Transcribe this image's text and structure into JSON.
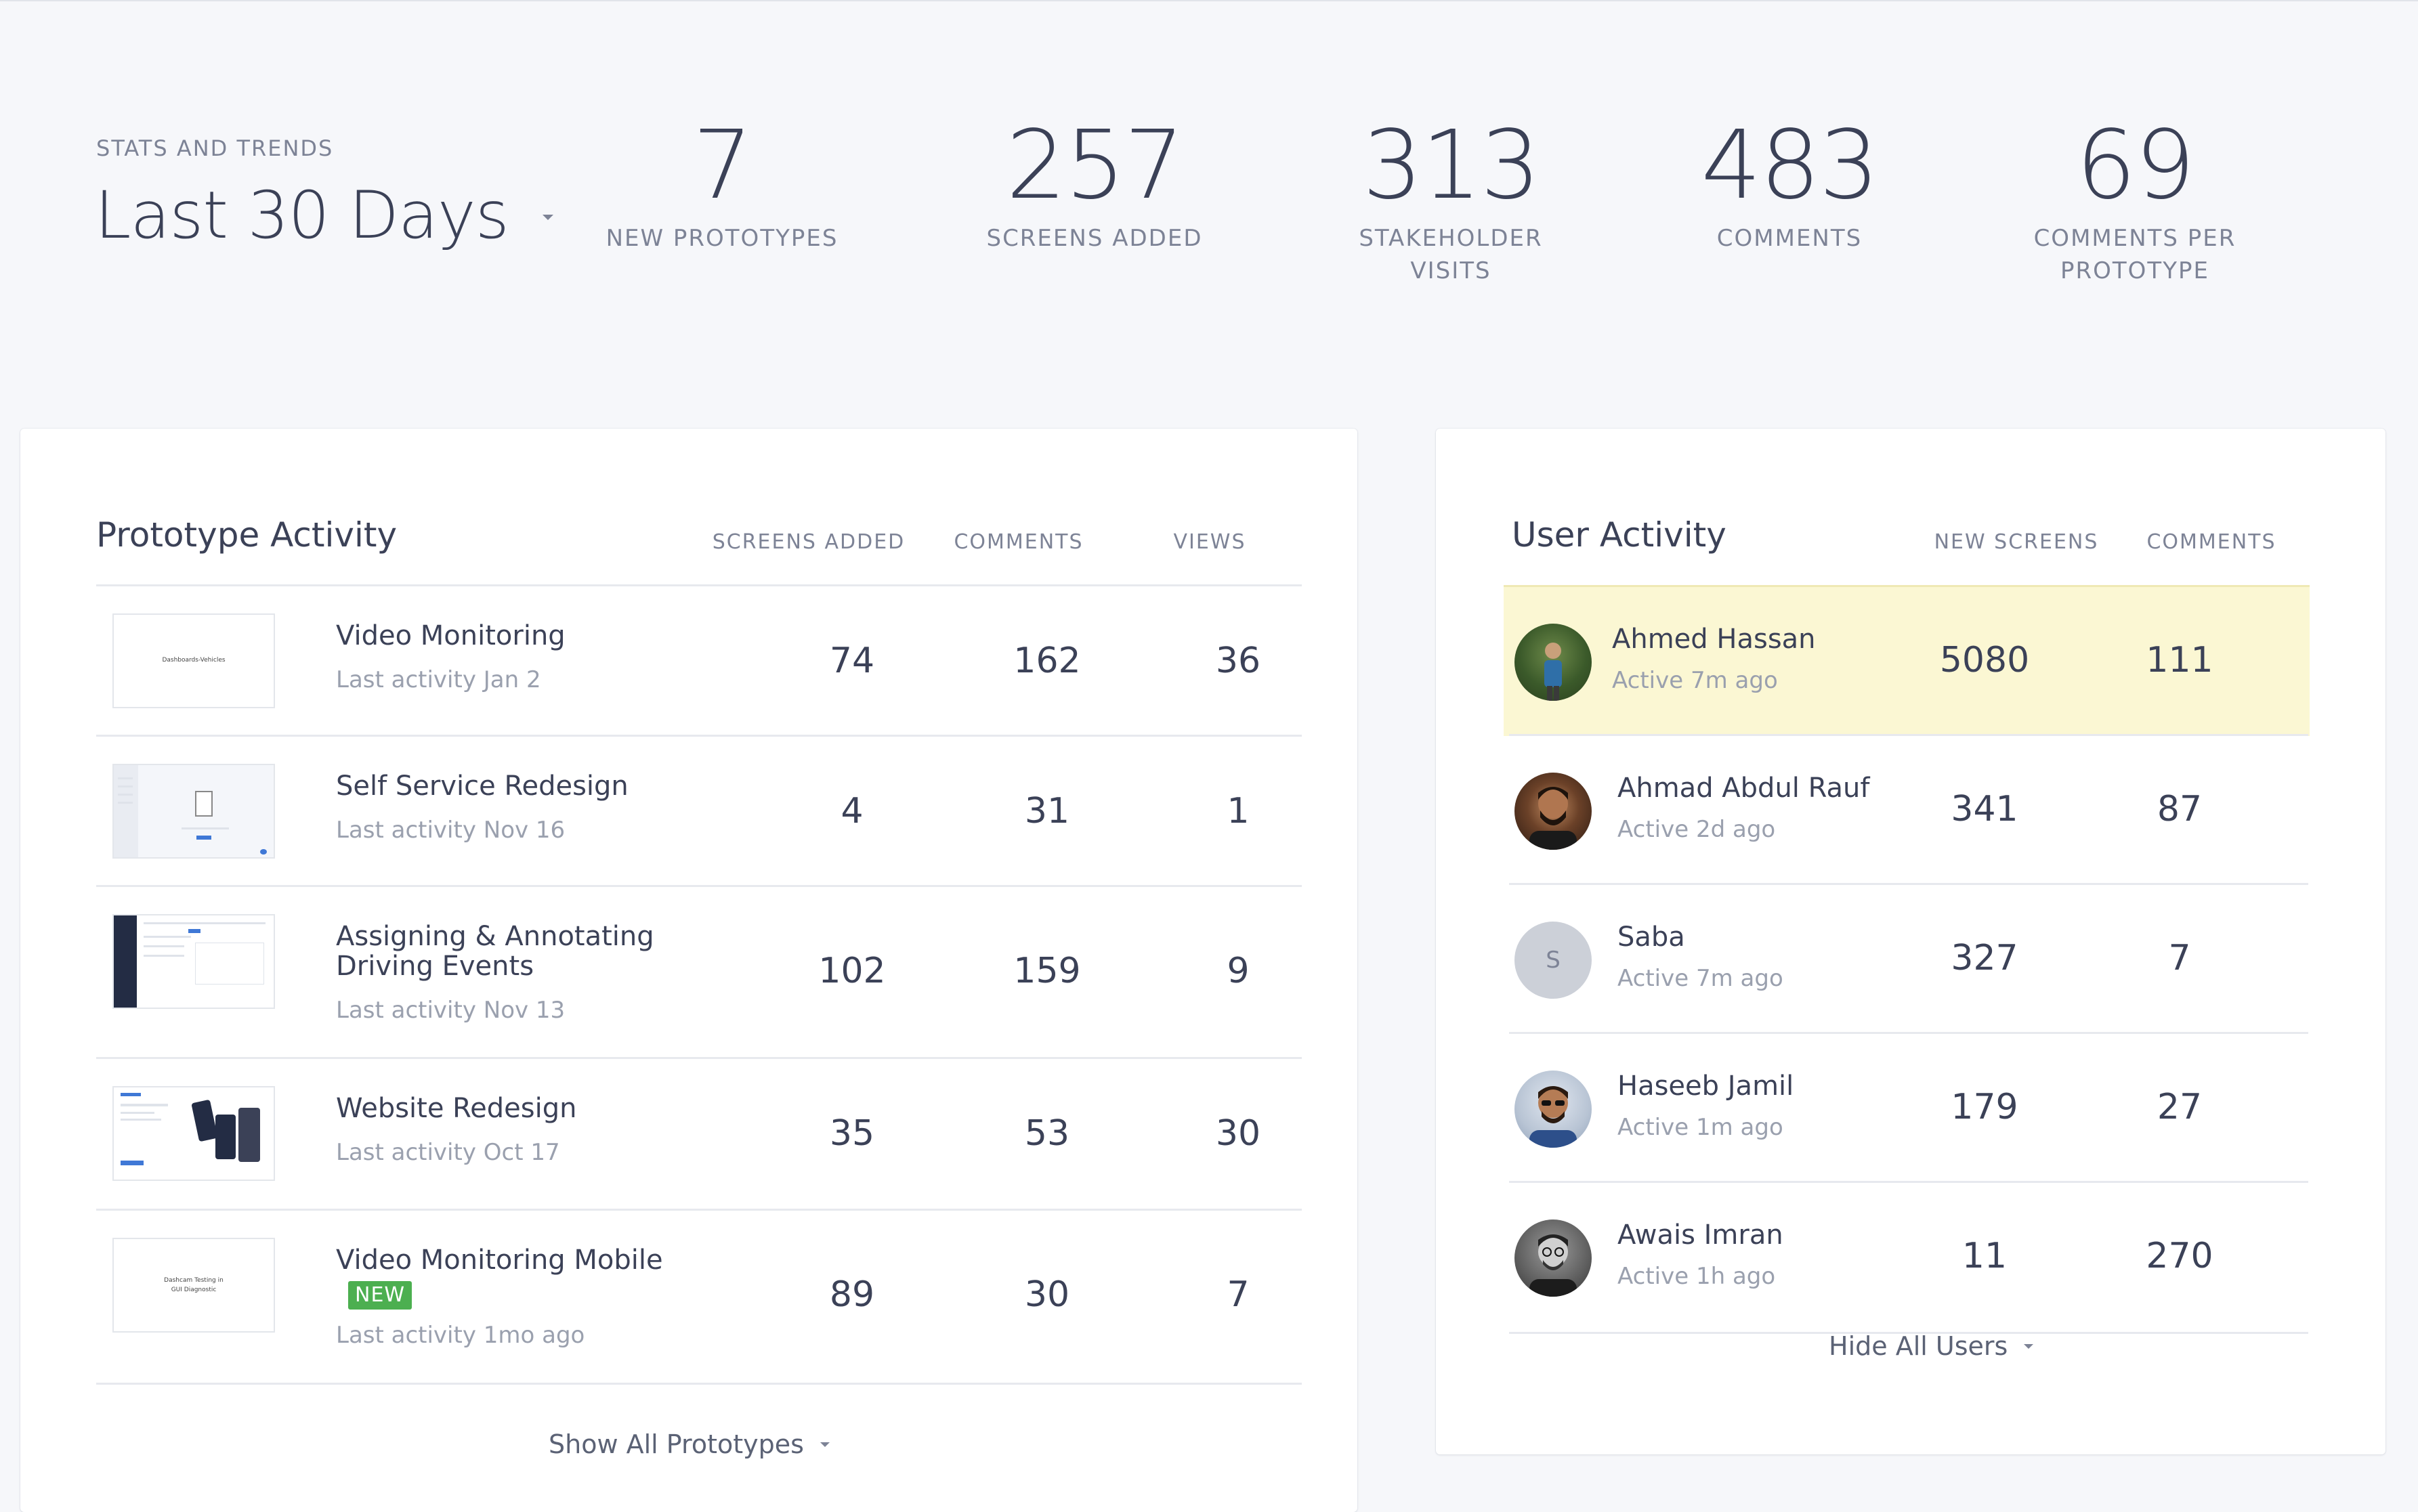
{
  "stats": {
    "heading": "STATS AND TRENDS",
    "range": "Last 30 Days",
    "items": [
      {
        "value": "7",
        "label": "NEW PROTOTYPES"
      },
      {
        "value": "257",
        "label": "SCREENS ADDED"
      },
      {
        "value": "313",
        "label": "STAKEHOLDER",
        "label2": "VISITS"
      },
      {
        "value": "483",
        "label": "COMMENTS"
      },
      {
        "value": "69",
        "label": "COMMENTS PER",
        "label2": "PROTOTYPE"
      }
    ]
  },
  "prototype_activity": {
    "title": "Prototype Activity",
    "columns": [
      "SCREENS ADDED",
      "COMMENTS",
      "VIEWS"
    ],
    "rows": [
      {
        "name": "Video Monitoring",
        "activity": "Last activity Jan 2",
        "screens": "74",
        "comments": "162",
        "views": "36",
        "thumb_text": "Dashboards-Vehicles"
      },
      {
        "name": "Self Service Redesign",
        "activity": "Last activity Nov 16",
        "screens": "4",
        "comments": "31",
        "views": "1"
      },
      {
        "name": "Assigning & Annotating",
        "name2": "Driving Events",
        "activity": "Last activity Nov 13",
        "screens": "102",
        "comments": "159",
        "views": "9"
      },
      {
        "name": "Website Redesign",
        "activity": "Last activity Oct 17",
        "screens": "35",
        "comments": "53",
        "views": "30"
      },
      {
        "name": "Video Monitoring Mobile",
        "badge": "NEW",
        "activity": "Last activity 1mo ago",
        "screens": "89",
        "comments": "30",
        "views": "7",
        "thumb_text": "Dashcam Testing in",
        "thumb_text2": "GUI Diagnostic"
      }
    ],
    "show_all": "Show All Prototypes"
  },
  "user_activity": {
    "title": "User Activity",
    "columns": [
      "NEW SCREENS",
      "COMMENTS"
    ],
    "rows": [
      {
        "name": "Ahmed Hassan",
        "status": "Active 7m ago",
        "screens": "5080",
        "comments": "111",
        "highlighted": true
      },
      {
        "name": "Ahmad Abdul Rauf",
        "status": "Active 2d ago",
        "screens": "341",
        "comments": "87"
      },
      {
        "name": "Saba",
        "initial": "S",
        "status": "Active 7m ago",
        "screens": "327",
        "comments": "7"
      },
      {
        "name": "Haseeb Jamil",
        "status": "Active 1m ago",
        "screens": "179",
        "comments": "27"
      },
      {
        "name": "Awais Imran",
        "status": "Active 1h ago",
        "screens": "11",
        "comments": "270"
      }
    ],
    "hide_all": "Hide All Users"
  },
  "colors": {
    "background": "#f6f7fa",
    "card": "#ffffff",
    "text": "#3b4157",
    "muted": "#7d8396",
    "highlight_row": "#fbf7d3",
    "new_badge": "#4caf50"
  }
}
